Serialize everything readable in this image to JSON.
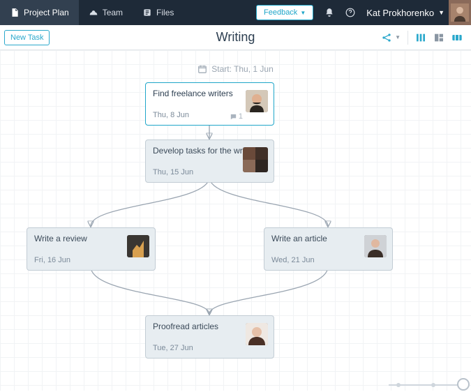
{
  "nav": {
    "project_plan": "Project Plan",
    "team": "Team",
    "files": "Files"
  },
  "top": {
    "feedback": "Feedback",
    "username": "Kat Prokhorenko"
  },
  "actions": {
    "new_task": "New Task"
  },
  "page": {
    "title": "Writing",
    "start_label": "Start: Thu, 1 Jun"
  },
  "nodes": {
    "n1": {
      "title": "Find freelance writers",
      "date": "Thu, 8 Jun",
      "comments": "1"
    },
    "n2": {
      "title": "Develop tasks for the writers",
      "date": "Thu, 15 Jun"
    },
    "n3": {
      "title": "Write a review",
      "date": "Fri, 16 Jun"
    },
    "n4": {
      "title": "Write an article",
      "date": "Wed, 21 Jun"
    },
    "n5": {
      "title": "Proofread articles",
      "date": "Tue, 27 Jun"
    }
  }
}
